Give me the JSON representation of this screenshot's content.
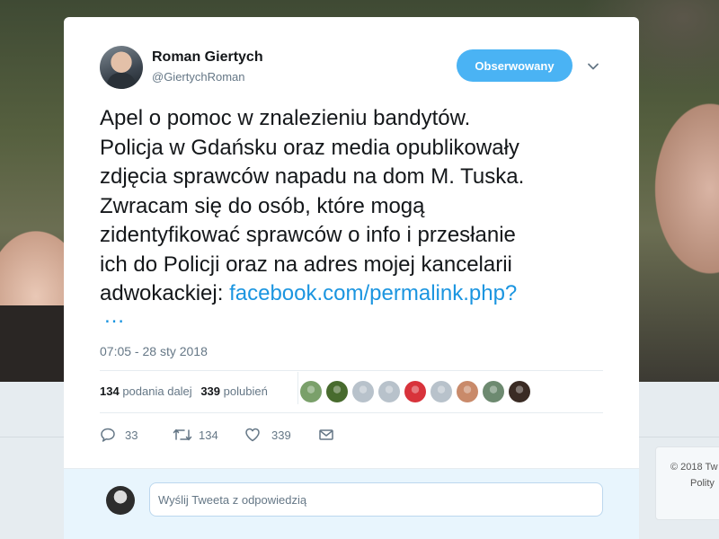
{
  "background": {
    "sidebar_lines": [
      "© 2018 Tw",
      "Polity"
    ]
  },
  "tweet": {
    "author_name": "Roman Giertych",
    "author_handle": "@GiertychRoman",
    "follow_label": "Obserwowany",
    "text_lines": [
      "Apel o pomoc w znalezieniu bandytów.",
      "Policja w Gdańsku oraz media opublikowały",
      "zdjęcia sprawców napadu na dom M. Tuska.",
      "Zwracam się do osób, które mogą",
      "zidentyfikować sprawców o info i przesłanie",
      "ich do Policji oraz na adres mojej kancelarii",
      "adwokackiej: "
    ],
    "link_text": "facebook.com/permalink.php?",
    "ellipsis": "…",
    "timestamp": "07:05 - 28 sty 2018",
    "retweets_count": "134",
    "retweets_label": "podania dalej",
    "likes_count": "339",
    "likes_label": "polubień",
    "liker_avatars": [
      "#7aa06a",
      "#486b2e",
      "#b8c2cb",
      "#b8c2cb",
      "#d8333b",
      "#b8c2cb",
      "#c98a6a",
      "#6d8a70",
      "#3a2b24"
    ],
    "actions": {
      "reply_count": "33",
      "retweet_count": "134",
      "like_count": "339"
    }
  },
  "reply_box": {
    "placeholder": "Wyślij Tweeta z odpowiedzią"
  },
  "colors": {
    "accent": "#1b95e0",
    "follow_button": "#4ab3f4",
    "secondary_text": "#657786"
  }
}
